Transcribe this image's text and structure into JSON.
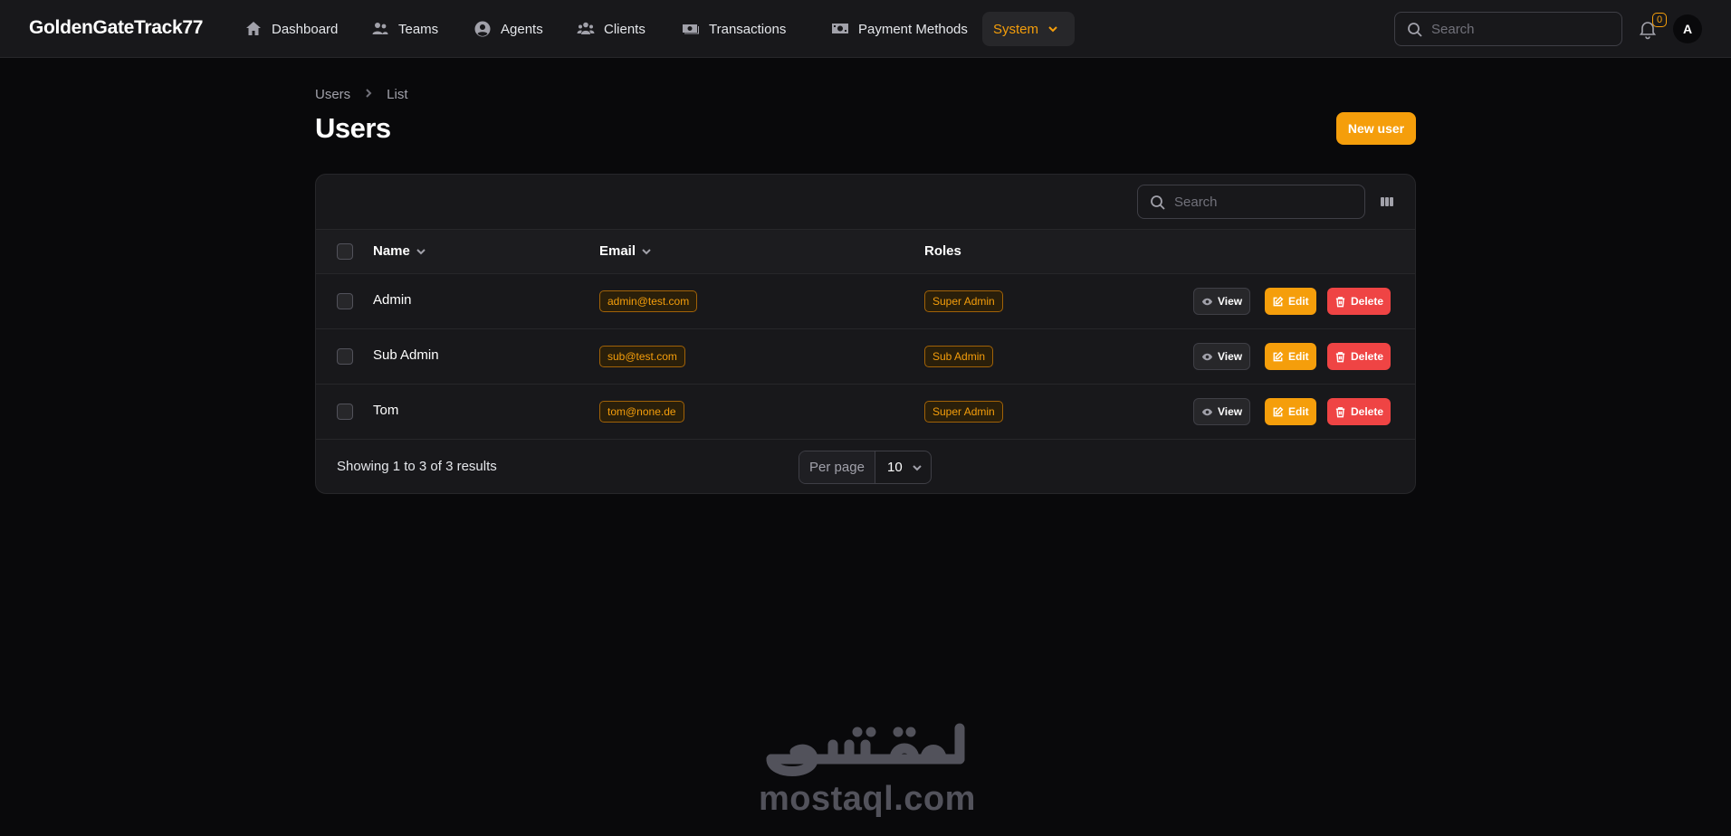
{
  "app": {
    "brand": "GoldenGateTrack77"
  },
  "nav": {
    "items": [
      {
        "label": "Dashboard",
        "icon": "home-icon"
      },
      {
        "label": "Teams",
        "icon": "users-group-icon"
      },
      {
        "label": "Agents",
        "icon": "user-circle-icon"
      },
      {
        "label": "Clients",
        "icon": "users-group-icon"
      },
      {
        "label": "Transactions",
        "icon": "banknotes-icon"
      },
      {
        "label": "Payment Methods",
        "icon": "money-icon"
      },
      {
        "label": "System",
        "icon": "chevron-down-icon",
        "active": true
      }
    ]
  },
  "top_search": {
    "placeholder": "Search"
  },
  "notifications": {
    "count": "0"
  },
  "user": {
    "avatar_initial": "A"
  },
  "breadcrumb": {
    "items": [
      "Users",
      "List"
    ]
  },
  "page": {
    "title": "Users",
    "new_button": "New user"
  },
  "table": {
    "search_placeholder": "Search",
    "columns": {
      "name": "Name",
      "email": "Email",
      "roles": "Roles"
    },
    "actions": {
      "view": "View",
      "edit": "Edit",
      "delete": "Delete"
    },
    "rows": [
      {
        "name": "Admin",
        "email": "admin@test.com",
        "role": "Super Admin"
      },
      {
        "name": "Sub Admin",
        "email": "sub@test.com",
        "role": "Sub Admin"
      },
      {
        "name": "Tom",
        "email": "tom@none.de",
        "role": "Super Admin"
      }
    ],
    "footer": {
      "showing": "Showing 1 to 3 of 3 results",
      "per_page_label": "Per page",
      "per_page_value": "10"
    }
  },
  "watermark": {
    "text": "mostaql.com",
    "logo_text": "مستقل"
  },
  "colors": {
    "accent": "#f59e0b",
    "danger": "#ef4444",
    "background": "#09090b",
    "surface": "#18181b"
  }
}
